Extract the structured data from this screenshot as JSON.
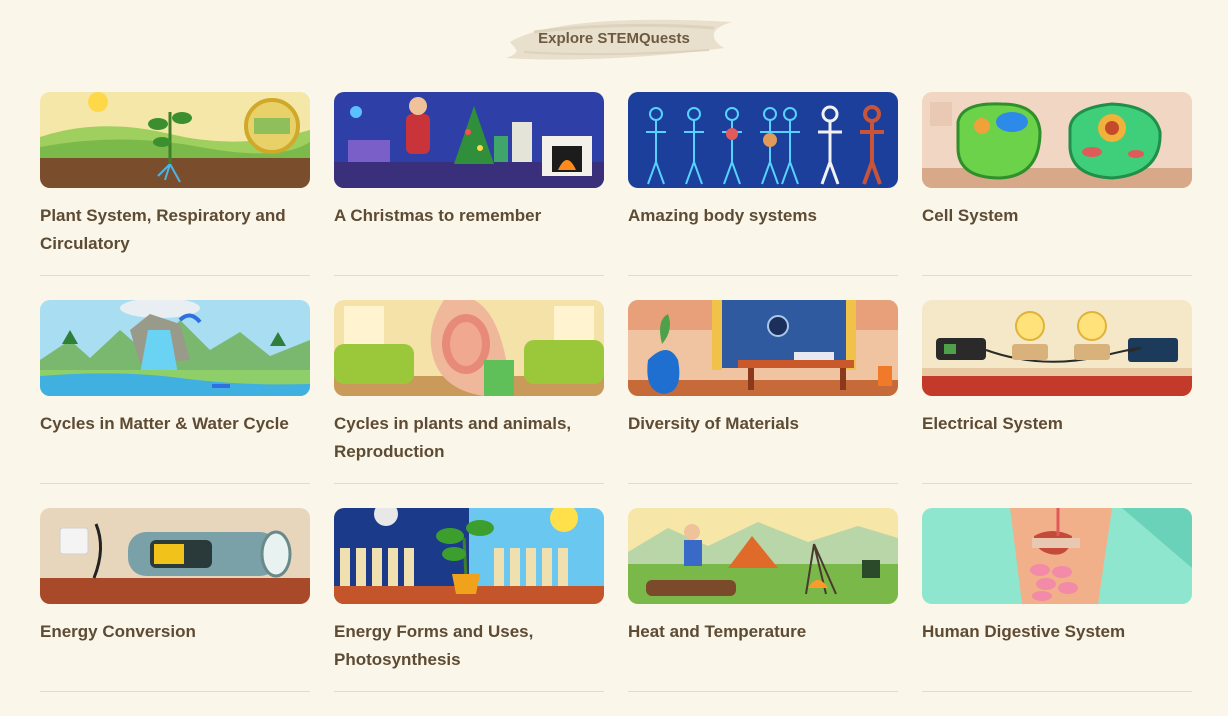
{
  "header": {
    "title": "Explore STEMQuests"
  },
  "cards": [
    {
      "title": "Plant System, Respiratory and Circulatory",
      "theme": "plant"
    },
    {
      "title": "A Christmas to remember",
      "theme": "christmas"
    },
    {
      "title": "Amazing body systems",
      "theme": "body"
    },
    {
      "title": "Cell System",
      "theme": "cell"
    },
    {
      "title": "Cycles in Matter & Water Cycle",
      "theme": "water"
    },
    {
      "title": "Cycles in plants and animals, Reproduction",
      "theme": "reproduction"
    },
    {
      "title": "Diversity of Materials",
      "theme": "materials"
    },
    {
      "title": "Electrical System",
      "theme": "electrical"
    },
    {
      "title": "Energy Conversion",
      "theme": "energy"
    },
    {
      "title": "Energy Forms and Uses, Photosynthesis",
      "theme": "photosynthesis"
    },
    {
      "title": "Heat and Temperature",
      "theme": "heat"
    },
    {
      "title": "Human Digestive System",
      "theme": "digestive"
    }
  ],
  "colors": {
    "background": "#fbf6ea",
    "text": "#5d4b33",
    "divider": "#e4dccb"
  }
}
